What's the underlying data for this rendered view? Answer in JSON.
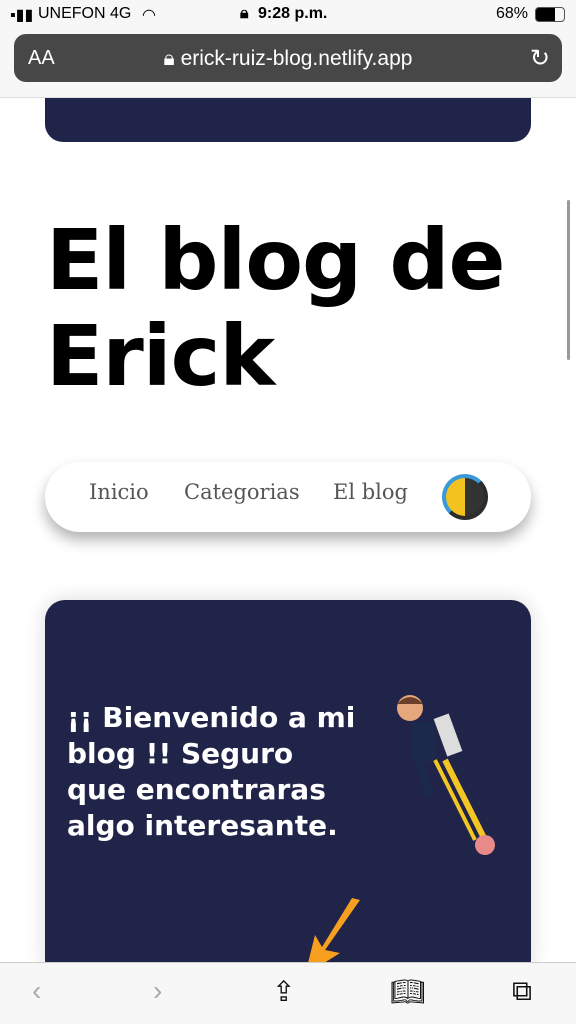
{
  "status": {
    "carrier": "UNEFON 4G",
    "time": "9:28 p.m.",
    "battery": "68%"
  },
  "browser": {
    "aa": "AA",
    "url": "erick-ruiz-blog.netlify.app"
  },
  "page": {
    "title": "El blog de Erick",
    "nav": [
      "Inicio",
      "Categorias",
      "El blog"
    ],
    "hero_text": "¡¡ Bienvenido a mi blog !! Seguro que encontraras algo interesante."
  },
  "colors": {
    "card": "#202448"
  }
}
